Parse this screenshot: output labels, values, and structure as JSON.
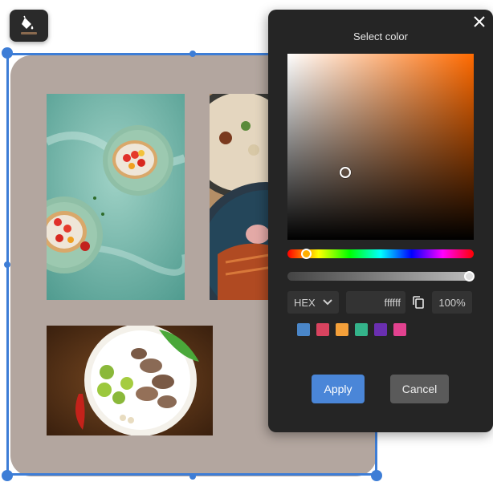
{
  "toolbar": {
    "fill_tool_icon": "paint-bucket-icon"
  },
  "canvas": {
    "background_color": "#b3a69f"
  },
  "picker": {
    "title": "Select color",
    "close_icon": "close-icon",
    "format_label": "HEX",
    "hex_value": "ffffff",
    "alpha_value": "100%",
    "copy_icon": "copy-icon",
    "hue_level": 0.1,
    "alpha_level": 1.0,
    "swatches": [
      "#4a86c8",
      "#d8435f",
      "#f4a03a",
      "#34b38a",
      "#6a2fb0",
      "#e2428f"
    ],
    "apply_label": "Apply",
    "cancel_label": "Cancel"
  },
  "accent_color": "#3d7dd6"
}
